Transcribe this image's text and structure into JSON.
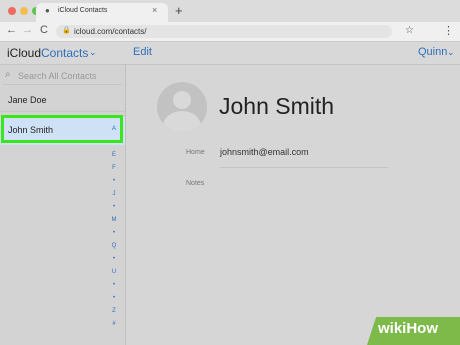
{
  "browser": {
    "tab_title": "iCloud Contacts",
    "tab_close": "×",
    "new_tab": "+",
    "url": "icloud.com/contacts/",
    "back": "←",
    "forward": "→",
    "reload": "C",
    "star": "☆",
    "menu": "⋮",
    "traffic_colors": [
      "#ee6a5f",
      "#f5bd4f",
      "#61c354"
    ]
  },
  "header": {
    "brand": "iCloud",
    "section": "Contacts",
    "section_chevron": "⌄",
    "edit_label": "Edit",
    "user": "Quinn",
    "user_chevron": "⌄"
  },
  "sidebar": {
    "search_placeholder": "Search All Contacts",
    "contacts": [
      {
        "name": "Jane Doe"
      },
      {
        "name": "John Smith",
        "selected": true
      }
    ],
    "index": [
      "A",
      "E",
      "F",
      "•",
      "J",
      "•",
      "M",
      "•",
      "Q",
      "•",
      "U",
      "•",
      "•",
      "Z",
      "#"
    ],
    "highlight_color": "#39e61c"
  },
  "detail": {
    "name": "John Smith",
    "home_label": "Home",
    "home_value": "johnsmith@email.com",
    "notes_label": "Notes"
  },
  "watermark": {
    "text": "wikiHow"
  },
  "colors": {
    "accent": "#2f6fb8",
    "selected_row": "#cfe2f5"
  }
}
